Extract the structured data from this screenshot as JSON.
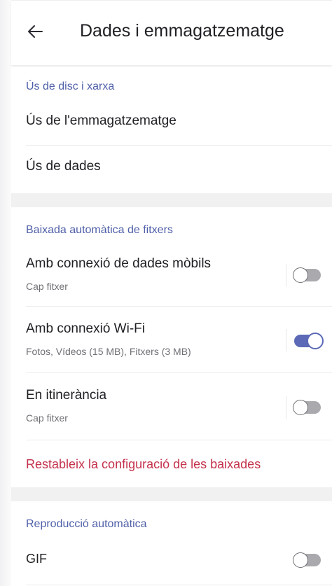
{
  "header": {
    "title": "Dades i emmagatzematge",
    "back_icon": "arrow-left-icon"
  },
  "disk_network": {
    "header": "Ús de disc i xarxa",
    "items": [
      {
        "label": "Ús de l'emmagatzematge"
      },
      {
        "label": "Ús de dades"
      }
    ]
  },
  "auto_download": {
    "header": "Baixada automàtica de fitxers",
    "items": [
      {
        "label": "Amb connexió de dades mòbils",
        "sub": "Cap fitxer",
        "enabled": false
      },
      {
        "label": "Amb connexió Wi-Fi",
        "sub": "Fotos, Vídeos (15 MB), Fitxers (3 MB)",
        "enabled": true
      },
      {
        "label": "En itinerància",
        "sub": "Cap fitxer",
        "enabled": false
      }
    ],
    "reset_label": "Restableix la configuració de les baixades"
  },
  "autoplay": {
    "header": "Reproducció automàtica",
    "items": [
      {
        "label": "GIF",
        "enabled": false
      }
    ]
  },
  "colors": {
    "accent": "#5b69b6",
    "section_header": "#4f5fa8",
    "danger": "#c4314b",
    "background_gap": "#f1f1f2"
  }
}
